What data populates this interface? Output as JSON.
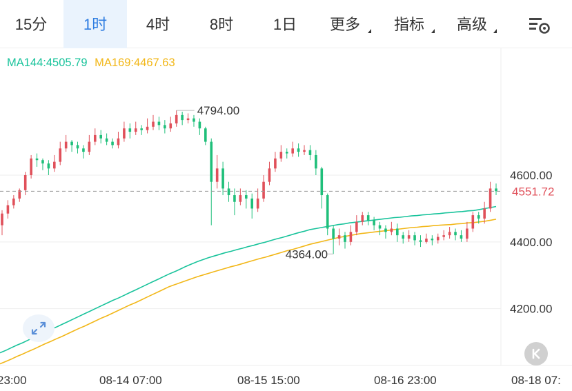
{
  "toolbar": {
    "tabs": [
      {
        "label": "15分",
        "active": false,
        "dropdown": false
      },
      {
        "label": "1时",
        "active": true,
        "dropdown": false
      },
      {
        "label": "4时",
        "active": false,
        "dropdown": false
      },
      {
        "label": "8时",
        "active": false,
        "dropdown": false
      },
      {
        "label": "1日",
        "active": false,
        "dropdown": false
      },
      {
        "label": "更多",
        "active": false,
        "dropdown": true
      },
      {
        "label": "指标",
        "active": false,
        "dropdown": true
      },
      {
        "label": "高级",
        "active": false,
        "dropdown": true
      }
    ],
    "settings_icon": "chart-settings-icon"
  },
  "legend": {
    "ma144": "MA144:4505.79",
    "ma169": "MA169:4467.63"
  },
  "colors": {
    "up": "#e0505a",
    "down": "#1fbf7a",
    "ma144": "#18c39b",
    "ma169": "#f2b718",
    "grid": "#eeeeee",
    "axis_text": "#333333",
    "active_tab": "#2f7de1",
    "last_price": "#e0505a"
  },
  "icons": {
    "expand": "expand-icon",
    "collapse": "collapse-icon"
  },
  "chart_data": {
    "type": "candlestick",
    "ylim": [
      4030,
      4980
    ],
    "y_ticks": [
      4200,
      4400,
      4600
    ],
    "y_tick_labels": [
      "4200.00",
      "4400.00",
      "4600.00"
    ],
    "x_tick_labels": [
      "23:00",
      "08-14 07:00",
      "08-15 15:00",
      "08-16 23:00",
      "08-18 07:"
    ],
    "last_price": 4551.72,
    "last_price_label": "4551.72",
    "high_annotation": {
      "value": 4794.0,
      "label": "4794.00"
    },
    "low_annotation": {
      "value": 4364.0,
      "label": "4364.00"
    },
    "candles": [
      [
        4450,
        4485,
        4420,
        4495
      ],
      [
        4485,
        4510,
        4470,
        4525
      ],
      [
        4510,
        4530,
        4500,
        4540
      ],
      [
        4530,
        4555,
        4520,
        4560
      ],
      [
        4555,
        4600,
        4540,
        4610
      ],
      [
        4600,
        4650,
        4590,
        4660
      ],
      [
        4650,
        4645,
        4625,
        4665
      ],
      [
        4645,
        4635,
        4615,
        4650
      ],
      [
        4635,
        4620,
        4600,
        4645
      ],
      [
        4620,
        4640,
        4610,
        4660
      ],
      [
        4640,
        4680,
        4630,
        4700
      ],
      [
        4680,
        4700,
        4670,
        4720
      ],
      [
        4700,
        4690,
        4670,
        4705
      ],
      [
        4690,
        4680,
        4665,
        4700
      ],
      [
        4680,
        4670,
        4650,
        4690
      ],
      [
        4670,
        4700,
        4660,
        4720
      ],
      [
        4700,
        4720,
        4690,
        4740
      ],
      [
        4720,
        4710,
        4695,
        4735
      ],
      [
        4710,
        4700,
        4690,
        4725
      ],
      [
        4700,
        4690,
        4680,
        4710
      ],
      [
        4690,
        4710,
        4680,
        4730
      ],
      [
        4710,
        4740,
        4700,
        4760
      ],
      [
        4740,
        4730,
        4710,
        4755
      ],
      [
        4730,
        4740,
        4720,
        4760
      ],
      [
        4740,
        4735,
        4720,
        4750
      ],
      [
        4735,
        4745,
        4725,
        4770
      ],
      [
        4745,
        4760,
        4735,
        4780
      ],
      [
        4760,
        4750,
        4735,
        4775
      ],
      [
        4750,
        4740,
        4725,
        4765
      ],
      [
        4740,
        4755,
        4730,
        4775
      ],
      [
        4755,
        4780,
        4745,
        4794
      ],
      [
        4780,
        4765,
        4750,
        4790
      ],
      [
        4765,
        4770,
        4755,
        4785
      ],
      [
        4770,
        4760,
        4745,
        4780
      ],
      [
        4760,
        4740,
        4720,
        4770
      ],
      [
        4740,
        4700,
        4690,
        4745
      ],
      [
        4700,
        4580,
        4450,
        4710
      ],
      [
        4580,
        4620,
        4560,
        4660
      ],
      [
        4620,
        4560,
        4540,
        4640
      ],
      [
        4560,
        4540,
        4520,
        4580
      ],
      [
        4540,
        4520,
        4480,
        4560
      ],
      [
        4520,
        4540,
        4510,
        4560
      ],
      [
        4540,
        4530,
        4500,
        4555
      ],
      [
        4530,
        4500,
        4470,
        4545
      ],
      [
        4500,
        4530,
        4490,
        4560
      ],
      [
        4530,
        4580,
        4520,
        4600
      ],
      [
        4580,
        4620,
        4570,
        4640
      ],
      [
        4620,
        4650,
        4610,
        4670
      ],
      [
        4650,
        4670,
        4640,
        4690
      ],
      [
        4670,
        4665,
        4650,
        4680
      ],
      [
        4665,
        4680,
        4655,
        4700
      ],
      [
        4680,
        4670,
        4655,
        4695
      ],
      [
        4670,
        4675,
        4660,
        4690
      ],
      [
        4675,
        4660,
        4645,
        4690
      ],
      [
        4660,
        4620,
        4600,
        4675
      ],
      [
        4620,
        4540,
        4500,
        4625
      ],
      [
        4540,
        4440,
        4420,
        4545
      ],
      [
        4440,
        4410,
        4364,
        4450
      ],
      [
        4410,
        4420,
        4390,
        4440
      ],
      [
        4420,
        4400,
        4380,
        4430
      ],
      [
        4400,
        4430,
        4390,
        4450
      ],
      [
        4430,
        4460,
        4420,
        4480
      ],
      [
        4460,
        4480,
        4450,
        4490
      ],
      [
        4480,
        4465,
        4450,
        4490
      ],
      [
        4465,
        4450,
        4435,
        4475
      ],
      [
        4450,
        4440,
        4420,
        4460
      ],
      [
        4440,
        4430,
        4410,
        4450
      ],
      [
        4430,
        4440,
        4420,
        4460
      ],
      [
        4440,
        4420,
        4400,
        4455
      ],
      [
        4420,
        4410,
        4395,
        4430
      ],
      [
        4410,
        4420,
        4400,
        4435
      ],
      [
        4420,
        4405,
        4390,
        4430
      ],
      [
        4405,
        4400,
        4385,
        4420
      ],
      [
        4400,
        4410,
        4395,
        4425
      ],
      [
        4410,
        4405,
        4390,
        4420
      ],
      [
        4405,
        4415,
        4395,
        4425
      ],
      [
        4415,
        4420,
        4405,
        4435
      ],
      [
        4420,
        4430,
        4410,
        4445
      ],
      [
        4430,
        4420,
        4405,
        4440
      ],
      [
        4420,
        4410,
        4400,
        4435
      ],
      [
        4410,
        4440,
        4400,
        4460
      ],
      [
        4440,
        4480,
        4430,
        4490
      ],
      [
        4480,
        4470,
        4455,
        4490
      ],
      [
        4470,
        4500,
        4455,
        4520
      ],
      [
        4500,
        4560,
        4490,
        4580
      ],
      [
        4560,
        4552,
        4540,
        4575
      ]
    ],
    "ma144": [
      4068,
      4075,
      4083,
      4091,
      4098,
      4106,
      4114,
      4122,
      4130,
      4138,
      4145,
      4153,
      4161,
      4169,
      4177,
      4185,
      4193,
      4201,
      4209,
      4217,
      4225,
      4232,
      4240,
      4248,
      4256,
      4264,
      4272,
      4280,
      4288,
      4296,
      4304,
      4311,
      4319,
      4327,
      4334,
      4341,
      4347,
      4353,
      4358,
      4363,
      4368,
      4372,
      4377,
      4381,
      4386,
      4390,
      4395,
      4399,
      4404,
      4409,
      4413,
      4418,
      4423,
      4428,
      4432,
      4437,
      4440,
      4443,
      4446,
      4449,
      4452,
      4454,
      4457,
      4459,
      4461,
      4463,
      4465,
      4467,
      4469,
      4471,
      4473,
      4474,
      4476,
      4478,
      4479,
      4481,
      4482,
      4484,
      4485,
      4487,
      4488,
      4490,
      4491,
      4493,
      4494,
      4497,
      4500,
      4503,
      4506
    ],
    "ma169": [
      4035,
      4042,
      4049,
      4057,
      4064,
      4072,
      4079,
      4087,
      4095,
      4102,
      4110,
      4117,
      4125,
      4133,
      4141,
      4148,
      4156,
      4164,
      4172,
      4179,
      4187,
      4195,
      4203,
      4211,
      4218,
      4226,
      4234,
      4242,
      4250,
      4258,
      4266,
      4272,
      4278,
      4284,
      4290,
      4296,
      4301,
      4306,
      4311,
      4316,
      4321,
      4326,
      4330,
      4335,
      4340,
      4345,
      4350,
      4354,
      4359,
      4364,
      4369,
      4374,
      4378,
      4383,
      4388,
      4393,
      4397,
      4401,
      4405,
      4409,
      4413,
      4416,
      4419,
      4422,
      4425,
      4427,
      4429,
      4431,
      4433,
      4435,
      4437,
      4439,
      4441,
      4443,
      4444,
      4446,
      4447,
      4449,
      4450,
      4451,
      4452,
      4454,
      4455,
      4457,
      4458,
      4460,
      4462,
      4465,
      4468
    ]
  }
}
